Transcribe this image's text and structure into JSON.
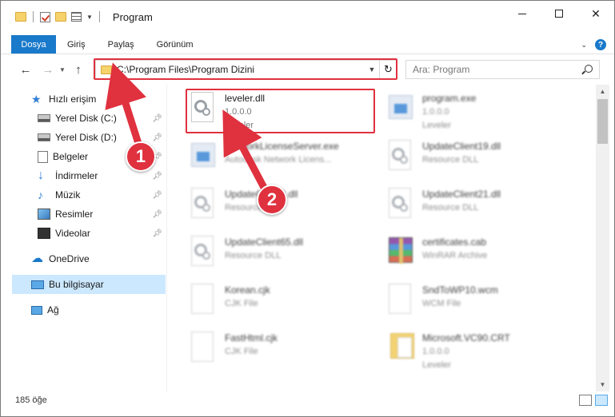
{
  "window": {
    "title": "Program",
    "controls": {
      "minimize": "min-icon",
      "maximize": "max-icon",
      "close": "✕"
    }
  },
  "ribbon": {
    "tabs": [
      "Dosya",
      "Giriş",
      "Paylaş",
      "Görünüm"
    ],
    "help": "?"
  },
  "address": {
    "path": "C:\\Program Files\\Program Dizini",
    "search_placeholder": "Ara: Program"
  },
  "sidebar": {
    "items": [
      {
        "label": "Hızlı erişim",
        "icon": "star-icon",
        "pinned": false
      },
      {
        "label": "Yerel Disk (C:)",
        "icon": "drive-icon",
        "pinned": true
      },
      {
        "label": "Yerel Disk (D:)",
        "icon": "drive-icon",
        "pinned": true
      },
      {
        "label": "Belgeler",
        "icon": "documents-icon",
        "pinned": true
      },
      {
        "label": "İndirmeler",
        "icon": "download-icon",
        "pinned": true
      },
      {
        "label": "Müzik",
        "icon": "music-icon",
        "pinned": true
      },
      {
        "label": "Resimler",
        "icon": "pictures-icon",
        "pinned": true
      },
      {
        "label": "Videolar",
        "icon": "videos-icon",
        "pinned": true
      },
      {
        "label": "OneDrive",
        "icon": "cloud-icon",
        "pinned": false
      },
      {
        "label": "Bu bilgisayar",
        "icon": "pc-icon",
        "pinned": false,
        "selected": true
      },
      {
        "label": "Ağ",
        "icon": "network-icon",
        "pinned": false
      }
    ]
  },
  "files": [
    {
      "name": "leveler.dll",
      "line2": "1.0.0.0",
      "line3": "Leveler",
      "icon": "dll-icon"
    },
    {
      "name": "program.exe",
      "line2": "1.0.0.0",
      "line3": "Leveler",
      "icon": "app-icon"
    },
    {
      "name": "NetworkLicenseServer.exe",
      "line2": "Autodesk Network Licens...",
      "line3": "",
      "icon": "app-icon"
    },
    {
      "name": "UpdateClient19.dll",
      "line2": "Resource DLL",
      "line3": "",
      "icon": "dll-icon"
    },
    {
      "name": "UpdateClient9.dll",
      "line2": "Resource DLL",
      "line3": "",
      "icon": "dll-icon"
    },
    {
      "name": "UpdateClient21.dll",
      "line2": "Resource DLL",
      "line3": "",
      "icon": "dll-icon"
    },
    {
      "name": "UpdateClient65.dll",
      "line2": "Resource DLL",
      "line3": "",
      "icon": "dll-icon"
    },
    {
      "name": "certificates.cab",
      "line2": "WinRAR Archive",
      "line3": "",
      "icon": "archive-icon"
    },
    {
      "name": "Korean.cjk",
      "line2": "CJK File",
      "line3": "",
      "icon": "file-icon"
    },
    {
      "name": "SndToWP10.wcm",
      "line2": "WCM File",
      "line3": "",
      "icon": "file-icon"
    },
    {
      "name": "FastHtml.cjk",
      "line2": "CJK File",
      "line3": "",
      "icon": "file-icon"
    },
    {
      "name": "Microsoft.VC90.CRT",
      "line2": "1.0.0.0",
      "line3": "Leveler",
      "icon": "folder-icon"
    }
  ],
  "status": {
    "count": "185 öğe"
  },
  "annotations": {
    "step1": "1",
    "step2": "2"
  },
  "colors": {
    "accent": "#1979ca",
    "highlight": "#e0313f",
    "selected": "#cce8ff"
  }
}
